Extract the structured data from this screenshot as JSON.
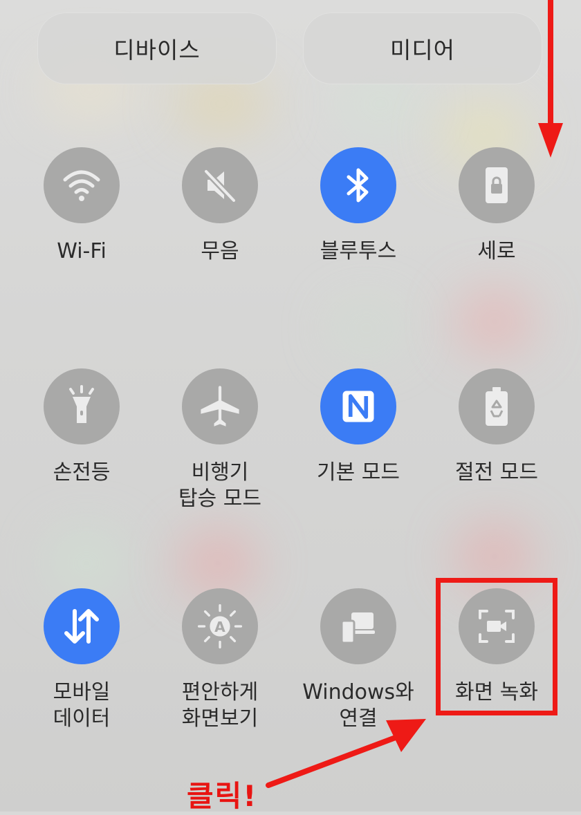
{
  "top_buttons": {
    "devices": "디바이스",
    "media": "미디어"
  },
  "tiles": [
    {
      "label": "Wi-Fi",
      "icon": "wifi-icon",
      "active": false
    },
    {
      "label": "무음",
      "icon": "mute-icon",
      "active": false
    },
    {
      "label": "블루투스",
      "icon": "bluetooth-icon",
      "active": true
    },
    {
      "label": "세로",
      "icon": "portrait-lock-icon",
      "active": false
    },
    {
      "label": "손전등",
      "icon": "flashlight-icon",
      "active": false
    },
    {
      "label": "비행기\n탑승 모드",
      "icon": "airplane-icon",
      "active": false
    },
    {
      "label": "기본 모드",
      "icon": "nfc-icon",
      "active": true
    },
    {
      "label": "절전 모드",
      "icon": "battery-saver-icon",
      "active": false
    },
    {
      "label": "모바일\n데이터",
      "icon": "mobile-data-icon",
      "active": true
    },
    {
      "label": "편안하게\n화면보기",
      "icon": "eye-comfort-icon",
      "active": false
    },
    {
      "label": "Windows와\n연결",
      "icon": "link-windows-icon",
      "active": false
    },
    {
      "label": "화면 녹화",
      "icon": "screen-record-icon",
      "active": false
    }
  ],
  "annotation": {
    "text": "클릭!"
  },
  "colors": {
    "active": "#3b7cf5",
    "inactive": "#a9a9a8",
    "annotation": "#ee1a16"
  }
}
